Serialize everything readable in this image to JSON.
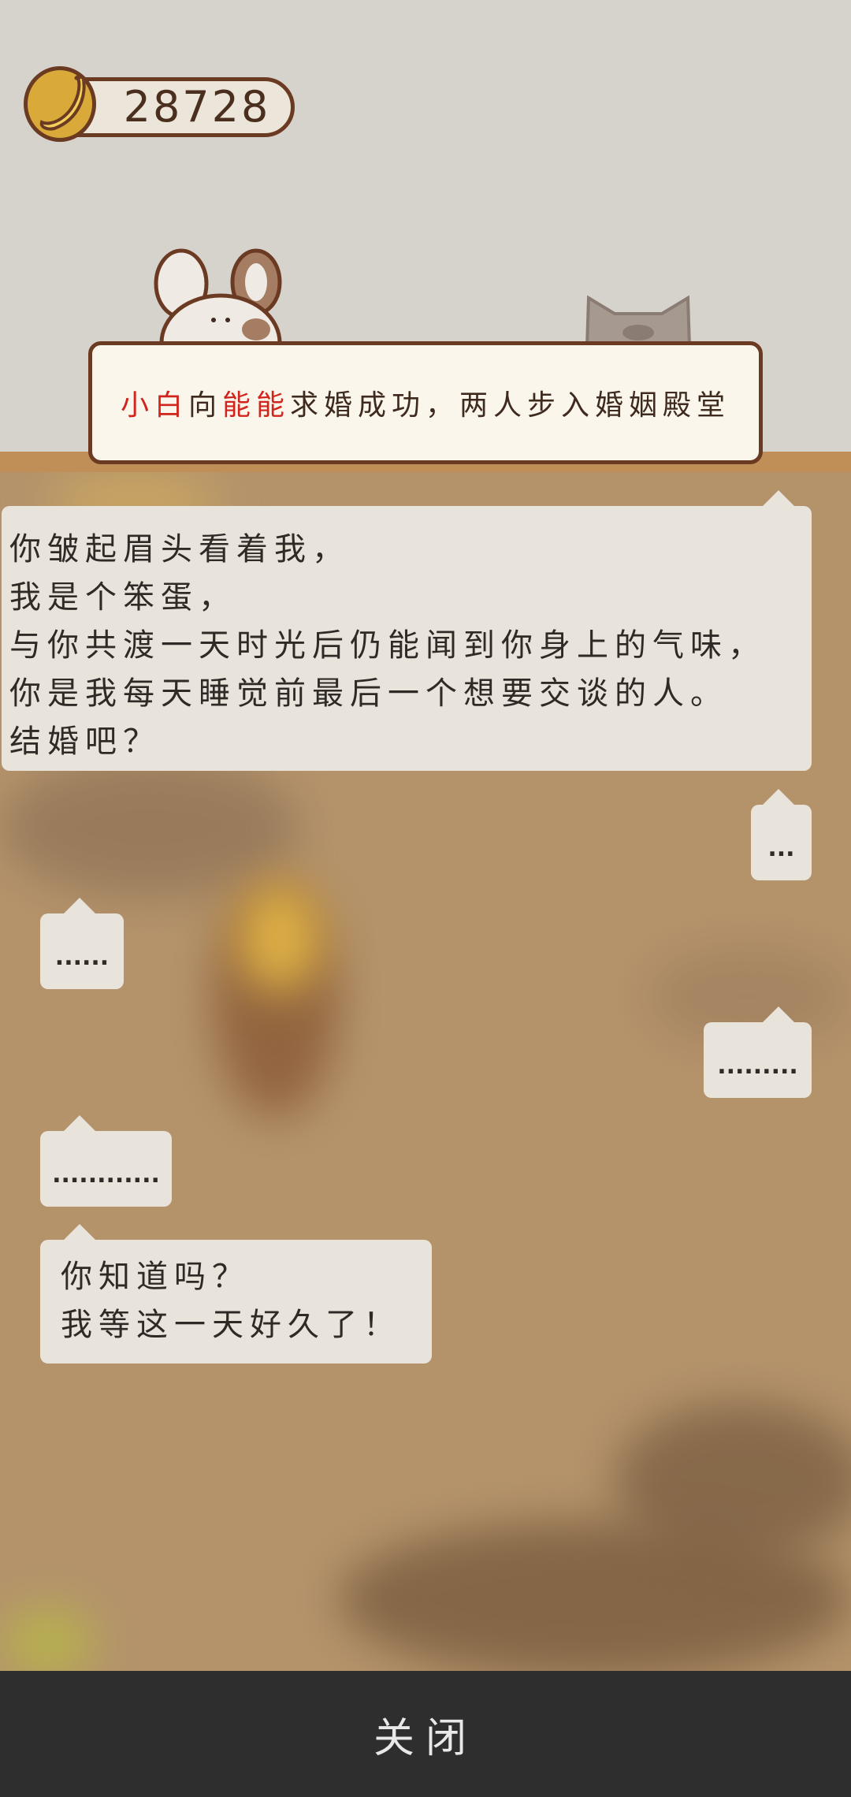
{
  "currency": {
    "icon": "banana-icon",
    "value": "28728"
  },
  "notice": {
    "name1": "小白",
    "conj": "向",
    "name2": "能能",
    "rest": "求婚成功，两人步入婚姻殿堂"
  },
  "dialogue": {
    "main_lines": [
      "你皱起眉头看着我，",
      "我是个笨蛋，",
      "与你共渡一天时光后仍能闻到你身上的气味，",
      "你是我每天睡觉前最后一个想要交谈的人。",
      "结婚吧？"
    ],
    "reply_1": "...",
    "reply_2": "......",
    "reply_3": ".........",
    "reply_4": "............",
    "final_lines": [
      "你知道吗？",
      "我等这一天好久了！"
    ]
  },
  "close_button": "关闭",
  "colors": {
    "accent_red": "#d0241c",
    "frame_brown": "#6b3a22",
    "bubble": "#e9e4db",
    "bar": "#2e2e2e"
  }
}
